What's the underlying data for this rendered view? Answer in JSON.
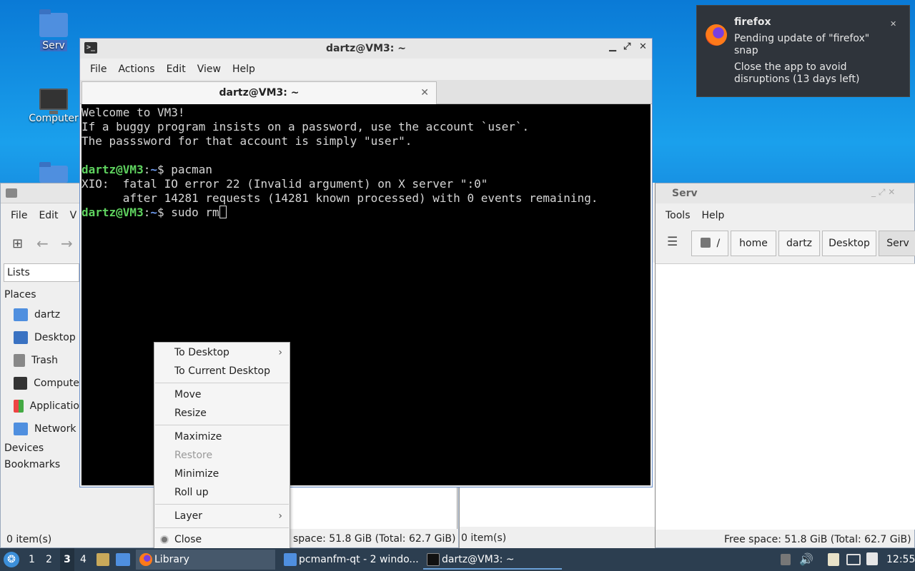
{
  "desktop": {
    "icons": [
      {
        "label": "Serv"
      },
      {
        "label": "Computer"
      }
    ]
  },
  "file_manager_left": {
    "menu": [
      "File",
      "Edit",
      "V"
    ],
    "lists_label": "Lists",
    "places_header": "Places",
    "places": [
      "dartz",
      "Desktop",
      "Trash",
      "Compute",
      "Applicatio",
      "Network"
    ],
    "devices_header": "Devices",
    "bookmarks_header": "Bookmarks",
    "status_items": "0 item(s)"
  },
  "file_manager_mid": {
    "free_space": "space: 51.8 GiB (Total: 62.7 GiB)",
    "status_items": "0 item(s)"
  },
  "file_manager_right": {
    "title": "Serv",
    "menu": [
      "Tools",
      "Help"
    ],
    "breadcrumb": [
      "/",
      "home",
      "dartz",
      "Desktop",
      "Serv"
    ],
    "free_space": "Free space: 51.8 GiB (Total: 62.7 GiB)"
  },
  "terminal": {
    "title": "dartz@VM3: ~",
    "menu": [
      "File",
      "Actions",
      "Edit",
      "View",
      "Help"
    ],
    "tab_label": "dartz@VM3: ~",
    "lines": [
      "Welcome to VM3!",
      "If a buggy program insists on a password, use the account `user`.",
      "The passsword for that account is simply \"user\".",
      ""
    ],
    "prompt_user": "dartz@VM3",
    "prompt_path": "~",
    "cmd1": "$ pacman",
    "err1": "XIO:  fatal IO error 22 (Invalid argument) on X server \":0\"",
    "err2": "      after 14281 requests (14281 known processed) with 0 events remaining.",
    "cmd2": "$ sudo rm"
  },
  "context_menu": {
    "items": {
      "to_desktop": "To Desktop",
      "to_current_desktop": "To Current Desktop",
      "move": "Move",
      "resize": "Resize",
      "maximize": "Maximize",
      "restore": "Restore",
      "minimize": "Minimize",
      "roll_up": "Roll up",
      "layer": "Layer",
      "close": "Close"
    }
  },
  "notification": {
    "app": "firefox",
    "line1": "Pending update of \"firefox\"",
    "line2": "snap",
    "line3": "Close the app to avoid",
    "line4": "disruptions (13 days left)"
  },
  "taskbar": {
    "workspaces": [
      "1",
      "2",
      "3",
      "4"
    ],
    "active_workspace": "3",
    "tasks": [
      "Library",
      "pcmanfm-qt - 2 windo...",
      "dartz@VM3: ~"
    ],
    "clock": "12:55"
  },
  "colors": {
    "terminal_prompt": "#5fd35f",
    "terminal_path": "#6f9cf0",
    "taskbar_bg": "#2c3e50"
  }
}
